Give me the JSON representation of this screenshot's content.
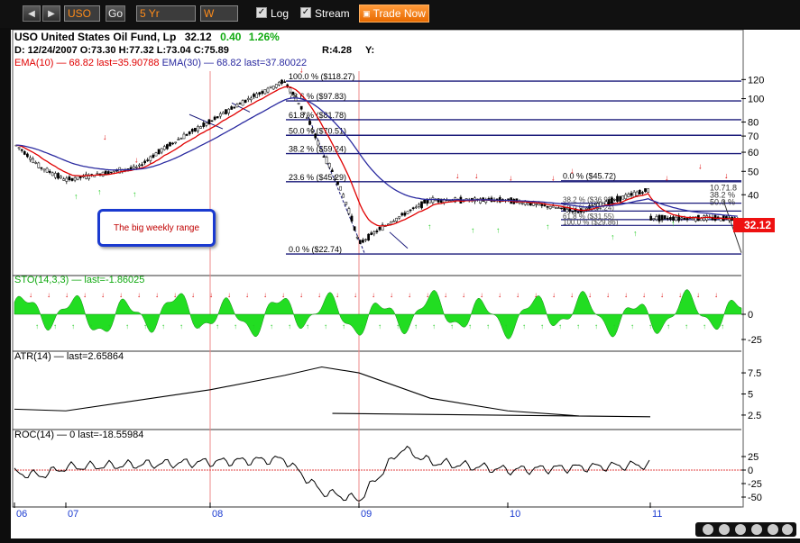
{
  "toolbar": {
    "symbol": "USO",
    "go_label": "Go",
    "period": "5 Yr",
    "interval": "W",
    "log_label": "Log",
    "stream_label": "Stream",
    "trade_label": "Trade Now",
    "log_checked": true,
    "stream_checked": true
  },
  "header": {
    "title": "USO United States Oil Fund, Lp",
    "last": "32.12",
    "change": "0.40",
    "pct": "1.26%",
    "ohlc": "D: 12/24/2007 O:73.30 H:77.32 L:73.04 C:75.89",
    "r_label": "R:4.28",
    "y_label": "Y:",
    "ema10": "EMA(10)",
    "ema10_vals": " — 68.82 last=35.90788",
    "ema30": "EMA(30)",
    "ema30_vals": " — 68.82 last=37.80022"
  },
  "annotation": "The big weekly range",
  "price_label": "32.12",
  "colors": {
    "up": "#000000",
    "ema10": "#e00000",
    "ema30": "#2a2aa0",
    "fib": "#1a1a7a",
    "osc_fill": "#22dd22",
    "arrow_up": "#22cc22",
    "arrow_down": "#dd0000",
    "price_badge": "#ee1111"
  },
  "chart_data": [
    {
      "type": "candlestick",
      "title": "USO United States Oil Fund, Lp",
      "y_scale": "log",
      "yticks": [
        30,
        40,
        50,
        60,
        70,
        80,
        100,
        120
      ],
      "xticks": [
        "06",
        "07",
        "08",
        "09",
        "10",
        "11"
      ],
      "close_approx": [
        {
          "x": "06",
          "y": 65
        },
        {
          "x": "06.5",
          "y": 52
        },
        {
          "x": "07",
          "y": 46
        },
        {
          "x": "07.5",
          "y": 52
        },
        {
          "x": "08",
          "y": 80
        },
        {
          "x": "08.5",
          "y": 118
        },
        {
          "x": "08.75",
          "y": 60
        },
        {
          "x": "09",
          "y": 25
        },
        {
          "x": "09.5",
          "y": 38
        },
        {
          "x": "10",
          "y": 38
        },
        {
          "x": "10.5",
          "y": 34
        },
        {
          "x": "11",
          "y": 42
        },
        {
          "x": "11.3",
          "y": 45
        },
        {
          "x": "11.5",
          "y": 32
        }
      ],
      "fibonacci": [
        {
          "label": "100.0 %",
          "value": "($118.27)",
          "price": 118.27
        },
        {
          "label": "78.6 %",
          "value": "($97.83)",
          "price": 97.83
        },
        {
          "label": "61.8 %",
          "value": "($81.78)",
          "price": 81.78
        },
        {
          "label": "50.0 %",
          "value": "($70.51)",
          "price": 70.51
        },
        {
          "label": "38.2 %",
          "value": "($59.24)",
          "price": 59.24
        },
        {
          "label": "23.6 %",
          "value": "($45.29)",
          "price": 45.29
        },
        {
          "label": "0.0 %",
          "value": "($22.74)",
          "price": 22.74
        }
      ],
      "fibonacci_small": [
        {
          "label": "0.0 %",
          "value": "($45.72)",
          "price": 45.72
        },
        {
          "label": "38.2 %",
          "value": "($36.92)",
          "price": 36.92
        },
        {
          "label": "50.0 %",
          "value": "($34.24)",
          "price": 34.24
        },
        {
          "label": "61.8 %",
          "value": "($31.55)",
          "price": 31.55
        },
        {
          "label": "100.0 %",
          "value": "($29.86)",
          "price": 29.86
        }
      ],
      "fib_right_labels": [
        "10.71.8",
        "38.2 %",
        "50.0 %"
      ]
    },
    {
      "type": "area",
      "title": "STO(14,3,3)",
      "legend": "STO(14,3,3) — last=-1.86025",
      "yticks": [
        0,
        -25
      ]
    },
    {
      "type": "line",
      "title": "ATR(14)",
      "legend": "ATR(14) — last=2.65864",
      "yticks": [
        7.5,
        5,
        2.5
      ],
      "points": [
        {
          "x": "06",
          "y": 3.2
        },
        {
          "x": "07",
          "y": 3.0
        },
        {
          "x": "08",
          "y": 5.5
        },
        {
          "x": "08.5",
          "y": 7.2
        },
        {
          "x": "08.75",
          "y": 8.2
        },
        {
          "x": "09",
          "y": 7.5
        },
        {
          "x": "09.5",
          "y": 4.5
        },
        {
          "x": "10",
          "y": 3.0
        },
        {
          "x": "10.5",
          "y": 2.4
        },
        {
          "x": "11",
          "y": 2.3
        },
        {
          "x": "11.5",
          "y": 2.7
        }
      ]
    },
    {
      "type": "line",
      "title": "ROC(14)",
      "legend": "ROC(14) — 0 last=-18.55984",
      "yticks": [
        25,
        0,
        -25,
        -50
      ],
      "points": [
        {
          "x": "06",
          "y": -5
        },
        {
          "x": "06.5",
          "y": -10
        },
        {
          "x": "07",
          "y": 5
        },
        {
          "x": "07.5",
          "y": 10
        },
        {
          "x": "08",
          "y": 15
        },
        {
          "x": "08.5",
          "y": 20
        },
        {
          "x": "08.75",
          "y": -40
        },
        {
          "x": "09",
          "y": -55
        },
        {
          "x": "09.3",
          "y": 40
        },
        {
          "x": "09.5",
          "y": 15
        },
        {
          "x": "10",
          "y": 0
        },
        {
          "x": "10.5",
          "y": 5
        },
        {
          "x": "11",
          "y": 10
        },
        {
          "x": "11.3",
          "y": 15
        },
        {
          "x": "11.5",
          "y": -18.56
        }
      ]
    }
  ]
}
